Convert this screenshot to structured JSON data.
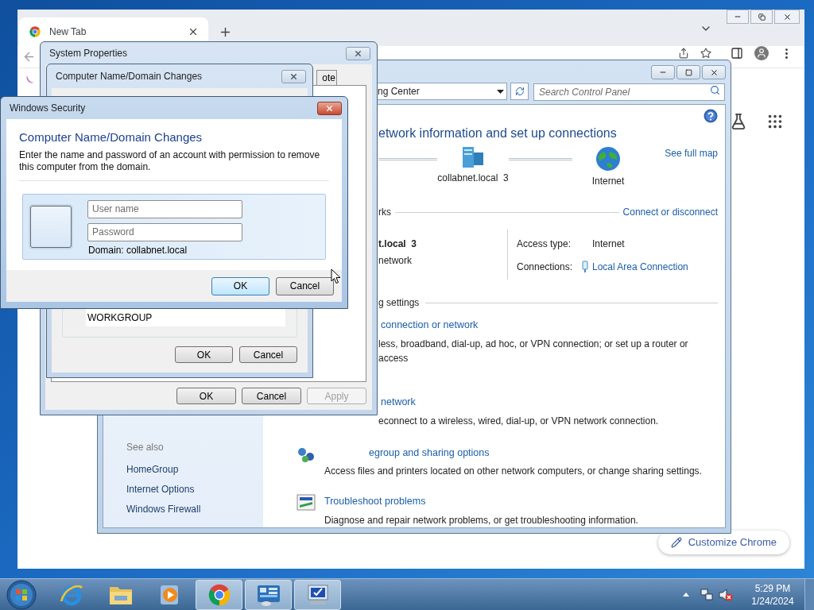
{
  "browser": {
    "tab": {
      "title": "New Tab"
    },
    "customize_button": "Customize Chrome"
  },
  "control_panel": {
    "address": "ng Center",
    "search": {
      "placeholder": "Search Control Panel"
    },
    "heading": "etwork information and set up connections",
    "map": [
      {
        "label": "collabnet.local  3",
        "kind": "domain"
      },
      {
        "label": "Internet",
        "kind": "internet"
      }
    ],
    "see_full_map": "See full map",
    "networks_heading": "rks",
    "connect_link": "Connect or disconnect",
    "network_name": "t.local  3",
    "network_type": "network",
    "access_type_label": "Access type:",
    "access_type": "Internet",
    "connections_label": "Connections:",
    "connection": "Local Area Connection",
    "settings_heading": "g settings",
    "tasks": [
      {
        "kind": "covered",
        "link": "connection or network",
        "description": "less, broadband, dial-up, ad hoc, or VPN connection; or set up a router or access"
      },
      {
        "kind": "covered",
        "link": "network",
        "description": "econnect to a wireless, wired, dial-up, or VPN network connection."
      },
      {
        "kind": "homegroup",
        "link": "egroup and sharing options",
        "description": "Access files and printers located on other network computers, or change sharing settings."
      },
      {
        "kind": "troubleshoot",
        "link": "Troubleshoot problems",
        "description": "Diagnose and repair network problems, or get troubleshooting information."
      }
    ],
    "see_also_heading": "See also",
    "see_also": [
      "HomeGroup",
      "Internet Options",
      "Windows Firewall"
    ]
  },
  "system_properties": {
    "title": "System Properties",
    "tab": "ote",
    "buttons": [
      {
        "label": "OK",
        "disabled": false
      },
      {
        "label": "Cancel",
        "disabled": false
      },
      {
        "label": "Apply",
        "disabled": true
      }
    ]
  },
  "domain_changes": {
    "title": "Computer Name/Domain Changes",
    "workgroup": "WORKGROUP",
    "buttons": [
      "OK",
      "Cancel"
    ]
  },
  "security": {
    "title": "Windows Security",
    "heading": "Computer Name/Domain Changes",
    "message": "Enter the name and password of an account with permission to remove this computer from the domain.",
    "username": {
      "placeholder": "User name"
    },
    "password": {
      "placeholder": "Password"
    },
    "domain": "Domain: collabnet.local",
    "buttons": [
      {
        "label": "OK",
        "focused": true
      },
      {
        "label": "Cancel",
        "focused": false
      }
    ]
  },
  "taskbar": {
    "apps": [
      {
        "kind": "ie",
        "active": false
      },
      {
        "kind": "explorer",
        "active": false
      },
      {
        "kind": "media",
        "active": false
      },
      {
        "kind": "chrome",
        "active": true
      },
      {
        "kind": "control_panel",
        "active": true
      },
      {
        "kind": "system",
        "active": true
      }
    ],
    "time": "5:29 PM",
    "date": "1/24/2024"
  }
}
